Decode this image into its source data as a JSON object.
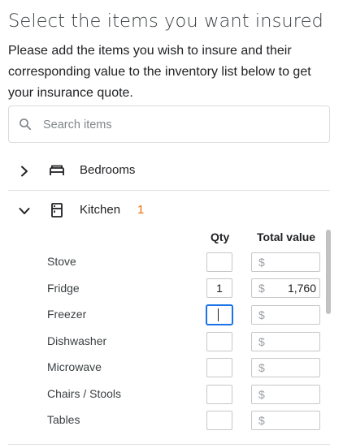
{
  "header": {
    "title": "Select the items you want insured",
    "subtitle": "Please add the items you wish to insure and their corresponding value to the inventory list below to get your insurance quote."
  },
  "search": {
    "placeholder": "Search items",
    "value": "",
    "icon": "search-icon"
  },
  "rooms": [
    {
      "label": "Bedrooms",
      "icon": "bed-icon",
      "expanded": false,
      "count": ""
    },
    {
      "label": "Kitchen",
      "icon": "fridge-icon",
      "expanded": true,
      "count": "1"
    }
  ],
  "kitchen": {
    "columns": {
      "qty": "Qty",
      "total_value": "Total value"
    },
    "currency_symbol": "$",
    "items": [
      {
        "name": "Stove",
        "qty": "",
        "value": ""
      },
      {
        "name": "Fridge",
        "qty": "1",
        "value": "1,760"
      },
      {
        "name": "Freezer",
        "qty": "",
        "value": "",
        "focused": true
      },
      {
        "name": "Dishwasher",
        "qty": "",
        "value": ""
      },
      {
        "name": "Microwave",
        "qty": "",
        "value": ""
      },
      {
        "name": "Chairs / Stools",
        "qty": "",
        "value": ""
      },
      {
        "name": "Tables",
        "qty": "",
        "value": ""
      }
    ]
  },
  "colors": {
    "count_badge": "#e8710a",
    "focus": "#1a73e8",
    "border": "#c7c7c7"
  }
}
